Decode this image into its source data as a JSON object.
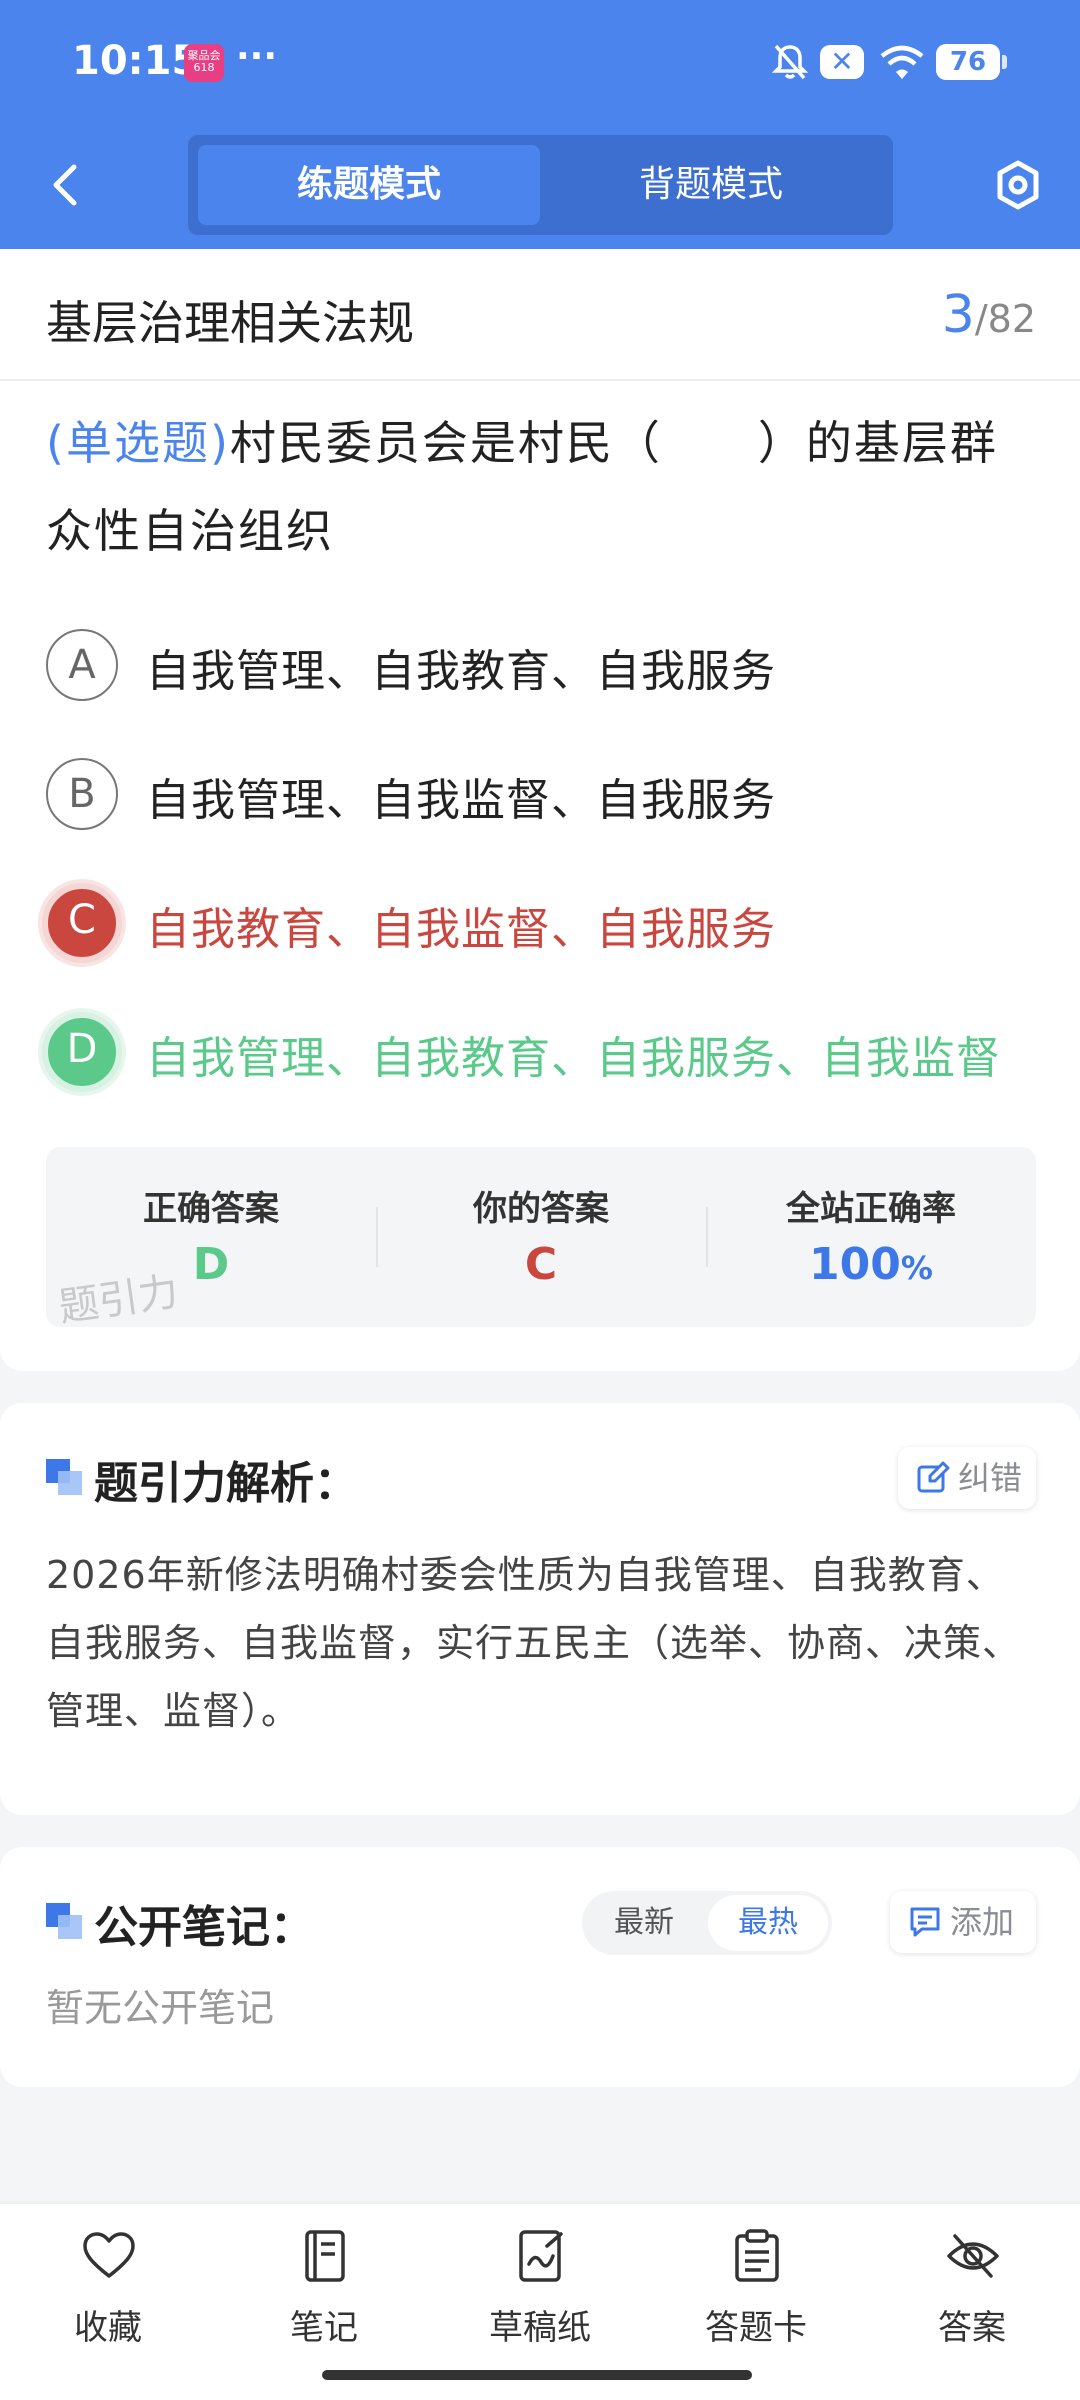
{
  "status_bar": {
    "time": "10:15",
    "app_badge": "聚品会\n618",
    "more": "···",
    "battery": "76"
  },
  "header": {
    "modes": [
      "练题模式",
      "背题模式"
    ],
    "active_mode_index": 0
  },
  "question": {
    "subject": "基层治理相关法规",
    "current": "3",
    "separator": "/",
    "total": "82",
    "type": "(单选题)",
    "text": "村民委员会是村民（　　）的基层群众性自治组织",
    "options": [
      {
        "letter": "A",
        "text": "自我管理、自我教育、自我服务",
        "state": "normal"
      },
      {
        "letter": "B",
        "text": "自我管理、自我监督、自我服务",
        "state": "normal"
      },
      {
        "letter": "C",
        "text": "自我教育、自我监督、自我服务",
        "state": "wrong"
      },
      {
        "letter": "D",
        "text": "自我管理、自我教育、自我服务、自我监督",
        "state": "correct"
      }
    ]
  },
  "result": {
    "correct_label": "正确答案",
    "correct_value": "D",
    "yours_label": "你的答案",
    "yours_value": "C",
    "rate_label": "全站正确率",
    "rate_value": "100",
    "rate_unit": "%",
    "watermark": "题引力"
  },
  "analysis": {
    "title": "题引力解析：",
    "report_label": "纠错",
    "text": "2026年新修法明确村委会性质为自我管理、自我教育、自我服务、自我监督，实行五民主（选举、协商、决策、管理、监督）。"
  },
  "notes": {
    "title": "公开笔记：",
    "sort_latest": "最新",
    "sort_hot": "最热",
    "add_label": "添加",
    "empty_text": "暂无公开笔记"
  },
  "bottom_nav": {
    "favorite": "收藏",
    "notes": "笔记",
    "scratch": "草稿纸",
    "answer_card": "答题卡",
    "answer": "答案"
  },
  "colors": {
    "primary": "#4a84ec",
    "wrong": "#c9473f",
    "correct": "#5ac98a"
  }
}
